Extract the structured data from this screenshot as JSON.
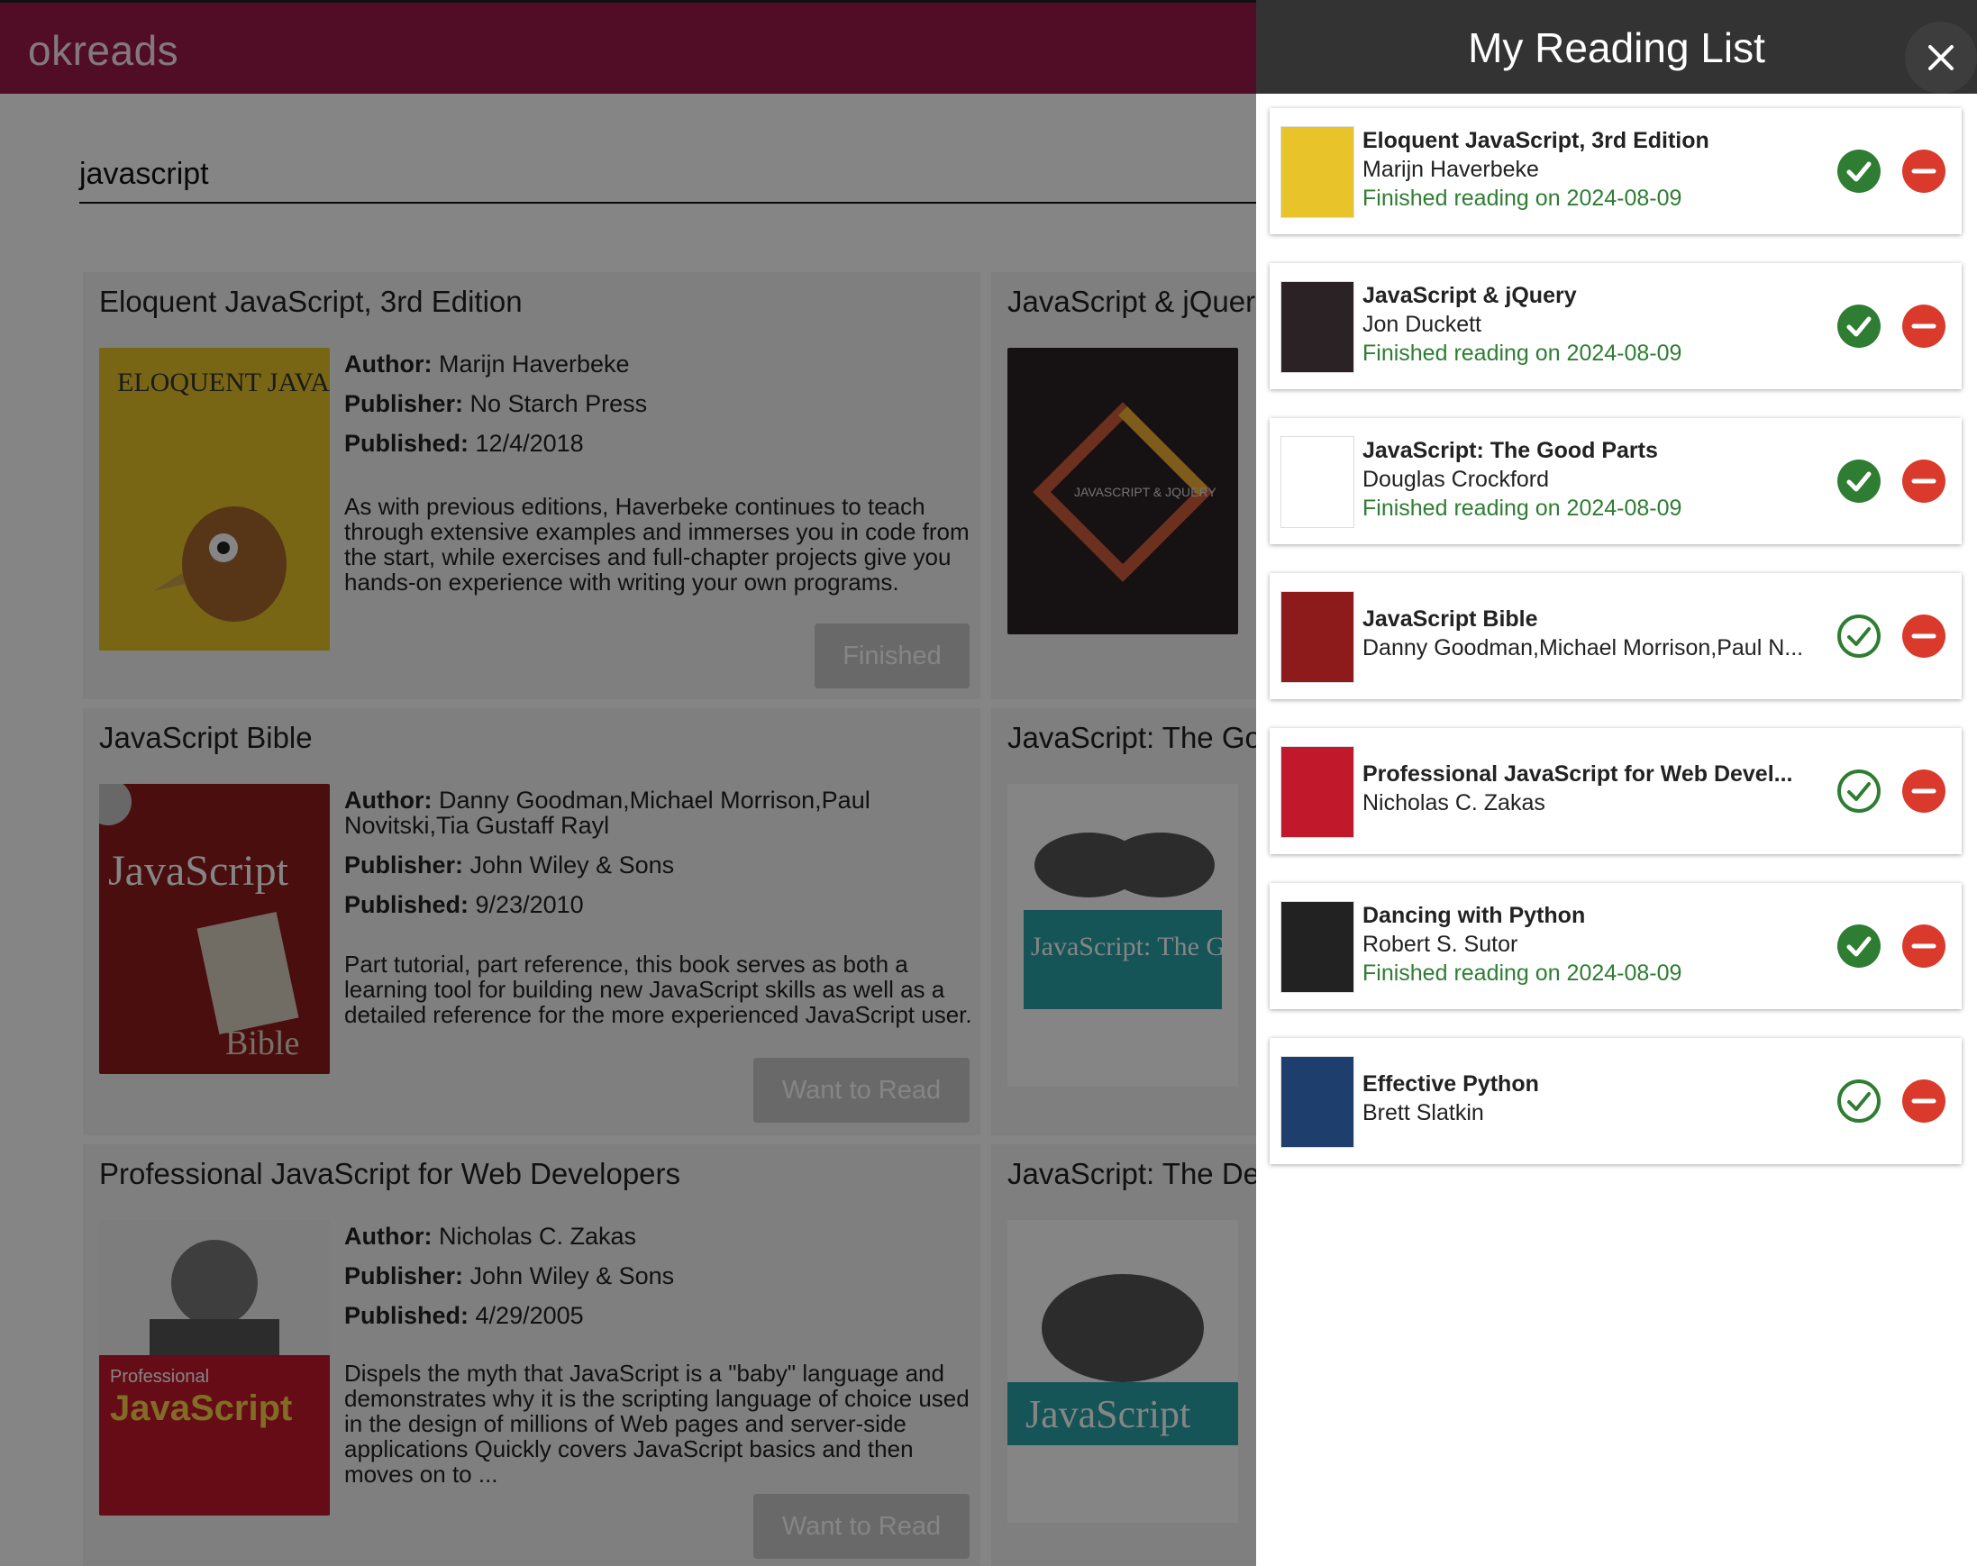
{
  "app": {
    "brand": "okreads"
  },
  "search": {
    "value": "javascript"
  },
  "results": [
    {
      "title": "Eloquent JavaScript, 3rd Edition",
      "author_label": "Author:",
      "author": "Marijn Haverbeke",
      "publisher_label": "Publisher:",
      "publisher": "No Starch Press",
      "published_label": "Published:",
      "published": "12/4/2018",
      "description": "As with previous editions, Haverbeke continues to teach through extensive examples and immerses you in code from the start, while exercises and full-chapter projects give you hands-on experience with writing your own programs.",
      "button": "Finished",
      "cover_text": "ELOQUENT JAVASCRIPT"
    },
    {
      "title": "JavaScript Bible",
      "author_label": "Author:",
      "author": "Danny Goodman,Michael Morrison,Paul Novitski,Tia Gustaff Rayl",
      "publisher_label": "Publisher:",
      "publisher": "John Wiley & Sons",
      "published_label": "Published:",
      "published": "9/23/2010",
      "description": "Part tutorial, part reference, this book serves as both a learning tool for building new JavaScript skills as well as a detailed reference for the more experienced JavaScript user.",
      "button": "Want to Read",
      "cover_text": "JavaScript"
    },
    {
      "title": "Professional JavaScript for Web Developers",
      "author_label": "Author:",
      "author": "Nicholas C. Zakas",
      "publisher_label": "Publisher:",
      "publisher": "John Wiley & Sons",
      "published_label": "Published:",
      "published": "4/29/2005",
      "description": "Dispels the myth that JavaScript is a \"baby\" language and demonstrates why it is the scripting language of choice used in the design of millions of Web pages and server-side applications Quickly covers JavaScript basics and then moves on to ...",
      "button": "Want to Read",
      "cover_text": "JavaScript"
    },
    {
      "title": "JavaScript & jQuer",
      "cover_text": "JAVASCRIPT & JQUERY"
    },
    {
      "title": "JavaScript: The Go",
      "cover_text": "JavaScript: The Good Parts"
    },
    {
      "title": "JavaScript: The De",
      "cover_text": "JavaScript"
    }
  ],
  "reading_list": {
    "title": "My Reading List",
    "items": [
      {
        "title": "Eloquent JavaScript, 3rd Edition",
        "author": "Marijn Haverbeke",
        "status": "Finished reading on 2024-08-09",
        "finished": true,
        "thumb_color": "#e8c42a"
      },
      {
        "title": "JavaScript & jQuery",
        "author": "Jon Duckett",
        "status": "Finished reading on 2024-08-09",
        "finished": true,
        "thumb_color": "#2b2226"
      },
      {
        "title": "JavaScript: The Good Parts",
        "author": "Douglas Crockford",
        "status": "Finished reading on 2024-08-09",
        "finished": true,
        "thumb_color": "#ffffff"
      },
      {
        "title": "JavaScript Bible",
        "author": "Danny Goodman,Michael Morrison,Paul N...",
        "status": "",
        "finished": false,
        "thumb_color": "#8e1b1b"
      },
      {
        "title": "Professional JavaScript for Web Devel...",
        "author": "Nicholas C. Zakas",
        "status": "",
        "finished": false,
        "thumb_color": "#c2182b"
      },
      {
        "title": "Dancing with Python",
        "author": "Robert S. Sutor",
        "status": "Finished reading on 2024-08-09",
        "finished": true,
        "thumb_color": "#222222"
      },
      {
        "title": "Effective Python",
        "author": "Brett Slatkin",
        "status": "",
        "finished": false,
        "thumb_color": "#1e3f6e"
      }
    ]
  },
  "colors": {
    "brand_bar": "#9b1a49",
    "panel_header": "#333333",
    "finished_green": "#2e7d32",
    "remove_red": "#d93a2b"
  },
  "icons": [
    "close-icon",
    "check-circle-filled-icon",
    "check-circle-outline-icon",
    "remove-circle-icon"
  ]
}
